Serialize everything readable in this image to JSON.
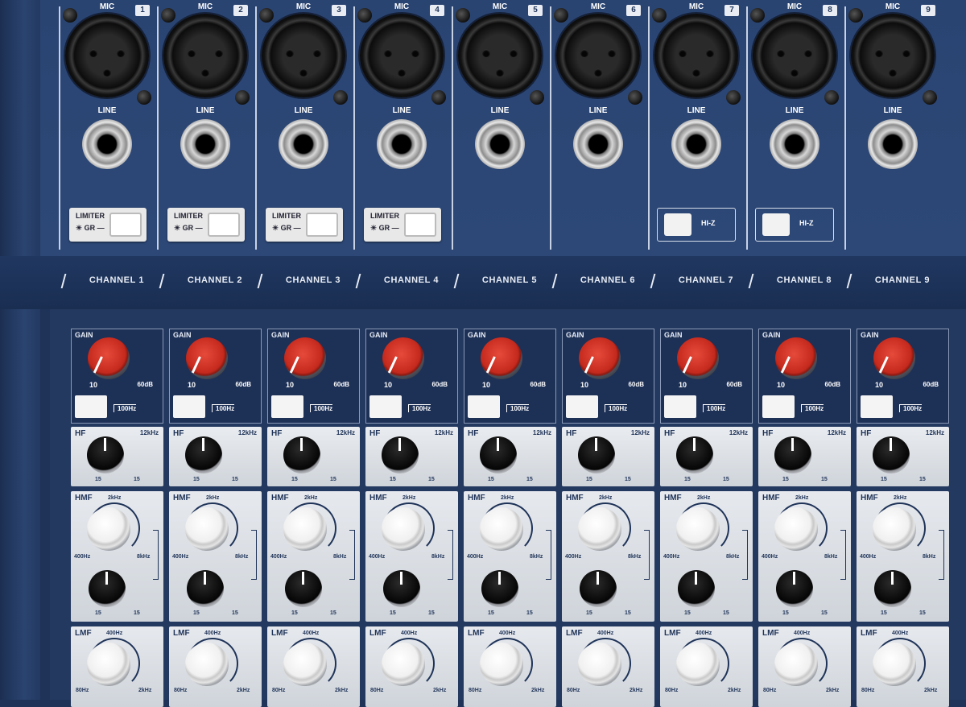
{
  "channels": [
    {
      "number": "1",
      "mic": "MIC",
      "line": "LINE",
      "label": "CHANNEL 1",
      "switch": "limiter"
    },
    {
      "number": "2",
      "mic": "MIC",
      "line": "LINE",
      "label": "CHANNEL 2",
      "switch": "limiter"
    },
    {
      "number": "3",
      "mic": "MIC",
      "line": "LINE",
      "label": "CHANNEL 3",
      "switch": "limiter"
    },
    {
      "number": "4",
      "mic": "MIC",
      "line": "LINE",
      "label": "CHANNEL 4",
      "switch": "limiter"
    },
    {
      "number": "5",
      "mic": "MIC",
      "line": "LINE",
      "label": "CHANNEL 5",
      "switch": "none"
    },
    {
      "number": "6",
      "mic": "MIC",
      "line": "LINE",
      "label": "CHANNEL 6",
      "switch": "none"
    },
    {
      "number": "7",
      "mic": "MIC",
      "line": "LINE",
      "label": "CHANNEL 7",
      "switch": "hiz"
    },
    {
      "number": "8",
      "mic": "MIC",
      "line": "LINE",
      "label": "CHANNEL 8",
      "switch": "hiz"
    },
    {
      "number": "9",
      "mic": "MIC",
      "line": "LINE",
      "label": "CHANNEL 9",
      "switch": "none"
    }
  ],
  "labels": {
    "limiter": "LIMITER",
    "gr": "GR",
    "hiz": "HI-Z",
    "gain": "GAIN",
    "gain_min": "10",
    "gain_max": "60dB",
    "highpass": "100Hz",
    "hf": "HF",
    "hf_freq": "12kHz",
    "hmf": "HMF",
    "hmf_top": "2kHz",
    "hmf_left": "400Hz",
    "hmf_right": "8kHz",
    "lmf": "LMF",
    "lmf_top": "400Hz",
    "lmf_left": "80Hz",
    "lmf_right": "2kHz",
    "boost_cut": "15"
  },
  "colors": {
    "panel_blue": "#24395f",
    "gain_red": "#d9382a",
    "eq_grey": "#d9dde3"
  }
}
